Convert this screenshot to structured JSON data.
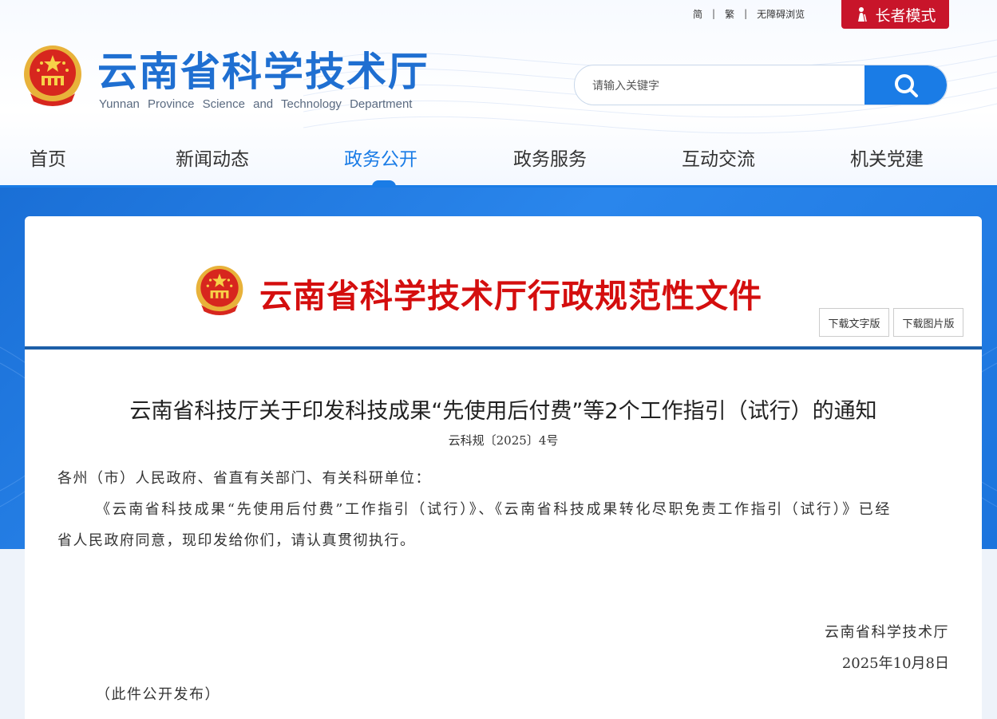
{
  "top_links": {
    "simplified": "简",
    "traditional": "繁",
    "accessibility": "无障碍浏览",
    "elder_mode": "长者模式"
  },
  "site": {
    "title": "云南省科学技术厅",
    "subtitle": "Yunnan Province Science and Technology Department"
  },
  "search": {
    "placeholder": "请输入关键字"
  },
  "nav": {
    "items": [
      "首页",
      "新闻动态",
      "政务公开",
      "政务服务",
      "互动交流",
      "机关党建"
    ],
    "active": "政务公开"
  },
  "document": {
    "type_heading": "云南省科学技术厅行政规范性文件",
    "download_text": "下载文字版",
    "download_image": "下载图片版",
    "title": "云南省科技厅关于印发科技成果“先使用后付费”等2个工作指引（试行）的通知",
    "number": "云科规〔2025〕4号",
    "salutation": "各州（市）人民政府、省直有关部门、有关科研单位：",
    "body_line1": "《云南省科技成果“先使用后付费”工作指引（试行）》、《云南省科技成果转化尽职免责工作指引（试行）》已经",
    "body_line2": "省人民政府同意，现印发给你们，请认真贯彻执行。",
    "issuer": "云南省科学技术厅",
    "date": "2025年10月8日",
    "publication_note": "（此件公开发布）"
  },
  "colors": {
    "brand_blue": "#1a7ce6",
    "title_blue": "#1f6fd1",
    "elder_red": "#c8152a",
    "heading_red": "#d40e0e"
  }
}
